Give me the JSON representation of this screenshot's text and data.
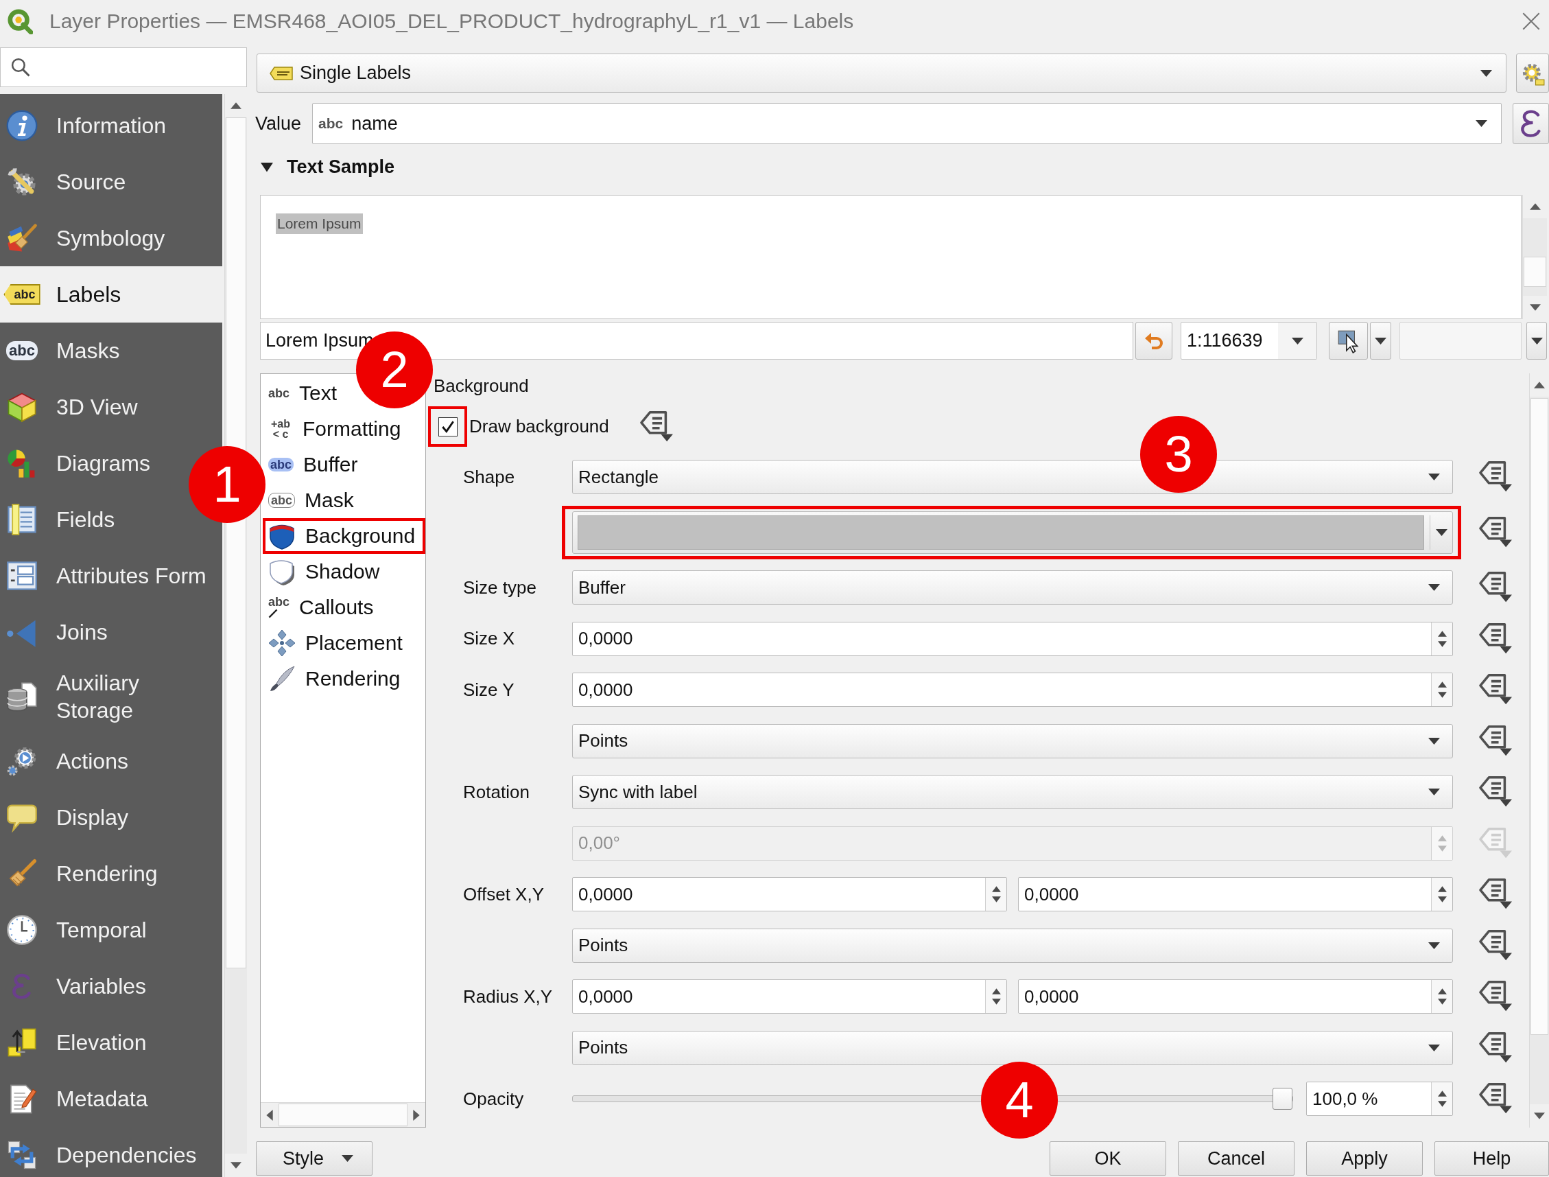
{
  "window": {
    "title": "Layer Properties — EMSR468_AOI05_DEL_PRODUCT_hydrographyL_r1_v1 — Labels"
  },
  "sidebar": {
    "items": [
      {
        "label": "Information",
        "selected": false
      },
      {
        "label": "Source",
        "selected": false
      },
      {
        "label": "Symbology",
        "selected": false
      },
      {
        "label": "Labels",
        "selected": true,
        "icon_text": "abc"
      },
      {
        "label": "Masks",
        "selected": false,
        "icon_text": "abc"
      },
      {
        "label": "3D View",
        "selected": false
      },
      {
        "label": "Diagrams",
        "selected": false
      },
      {
        "label": "Fields",
        "selected": false
      },
      {
        "label": "Attributes Form",
        "selected": false
      },
      {
        "label": "Joins",
        "selected": false
      },
      {
        "label": "Auxiliary Storage",
        "selected": false
      },
      {
        "label": "Actions",
        "selected": false
      },
      {
        "label": "Display",
        "selected": false
      },
      {
        "label": "Rendering",
        "selected": false
      },
      {
        "label": "Temporal",
        "selected": false
      },
      {
        "label": "Variables",
        "selected": false
      },
      {
        "label": "Elevation",
        "selected": false
      },
      {
        "label": "Metadata",
        "selected": false
      },
      {
        "label": "Dependencies",
        "selected": false
      }
    ]
  },
  "renderer": {
    "value": "Single Labels"
  },
  "value_field": {
    "label": "Value",
    "type": "abc",
    "value": "name"
  },
  "text_sample": {
    "title": "Text Sample",
    "expanded": true,
    "preview": "Lorem Ipsum",
    "sample_text": "Lorem Ipsum",
    "scale": "1:116639"
  },
  "tabs": [
    {
      "label": "Text",
      "icon_text": "abc",
      "highlighted": false
    },
    {
      "label": "Formatting",
      "icon_text": "+ab < c",
      "highlighted": false
    },
    {
      "label": "Buffer",
      "icon_text": "abc",
      "highlighted": false
    },
    {
      "label": "Mask",
      "icon_text": "abc",
      "highlighted": false
    },
    {
      "label": "Background",
      "highlighted": true
    },
    {
      "label": "Shadow",
      "highlighted": false
    },
    {
      "label": "Callouts",
      "icon_text": "abc",
      "highlighted": false
    },
    {
      "label": "Placement",
      "highlighted": false
    },
    {
      "label": "Rendering",
      "highlighted": false
    }
  ],
  "background": {
    "title": "Background",
    "draw_background": {
      "label": "Draw background",
      "checked": true,
      "highlighted": true
    },
    "rows": [
      {
        "kind": "combo",
        "label": "Shape",
        "value": "Rectangle",
        "disabled": false,
        "highlighted": false
      },
      {
        "kind": "color",
        "color": "#c0c0c0",
        "disabled": false,
        "highlighted": true
      },
      {
        "kind": "combo",
        "label": "Size type",
        "value": "Buffer",
        "disabled": false,
        "highlighted": false
      },
      {
        "kind": "spin",
        "label": "Size X",
        "value": "0,0000",
        "disabled": false,
        "highlighted": false
      },
      {
        "kind": "spin",
        "label": "Size Y",
        "value": "0,0000",
        "disabled": false,
        "highlighted": false
      },
      {
        "kind": "combo",
        "value": "Points",
        "disabled": false,
        "highlighted": false
      },
      {
        "kind": "combo",
        "label": "Rotation",
        "value": "Sync with label",
        "disabled": false,
        "highlighted": false
      },
      {
        "kind": "spin",
        "value": "0,00°",
        "disabled": true,
        "highlighted": false
      },
      {
        "kind": "spin_pair",
        "label": "Offset X,Y",
        "values": [
          "0,0000",
          "0,0000"
        ],
        "disabled": false,
        "highlighted": false
      },
      {
        "kind": "combo",
        "value": "Points",
        "disabled": false,
        "highlighted": false
      },
      {
        "kind": "spin_pair",
        "label": "Radius X,Y",
        "values": [
          "0,0000",
          "0,0000"
        ],
        "disabled": false,
        "highlighted": false
      },
      {
        "kind": "combo",
        "value": "Points",
        "disabled": false,
        "highlighted": false
      },
      {
        "kind": "slider",
        "label": "Opacity",
        "level": 1.0,
        "reading": "100,0 %",
        "disabled": false,
        "highlighted": false
      }
    ]
  },
  "buttons": [
    {
      "label": "Style",
      "kind": "menu"
    },
    {
      "label": "OK",
      "kind": "push"
    },
    {
      "label": "Cancel",
      "kind": "push"
    },
    {
      "label": "Apply",
      "kind": "push"
    },
    {
      "label": "Help",
      "kind": "push"
    }
  ],
  "annotations": [
    {
      "label": "1"
    },
    {
      "label": "2"
    },
    {
      "label": "3"
    },
    {
      "label": "4"
    }
  ]
}
